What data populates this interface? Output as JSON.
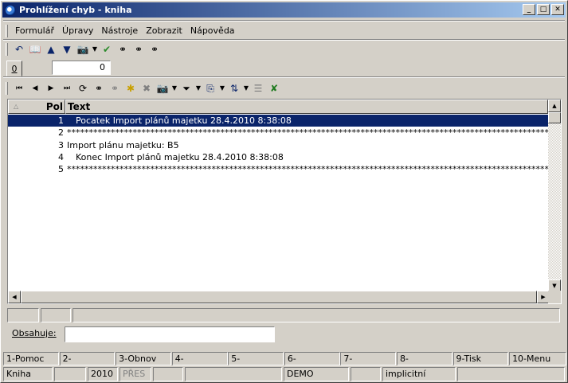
{
  "window": {
    "title": "Prohlížení chyb - kniha"
  },
  "menu": [
    "Formulář",
    "Úpravy",
    "Nástroje",
    "Zobrazit",
    "Nápověda"
  ],
  "toolbar1": {
    "icons": [
      "undo-icon",
      "book-icon",
      "arrow-up-icon",
      "arrow-down-icon",
      "camera-icon",
      "dropdown-arrow-icon",
      "filter-check-icon",
      "binoculars-icon",
      "binoculars-next-icon",
      "binoculars-prev-icon"
    ]
  },
  "tabs": {
    "active": "0"
  },
  "number_field": {
    "value": "0"
  },
  "toolbar2": {
    "icons": [
      "first-record-icon",
      "prev-record-icon",
      "next-record-icon",
      "last-record-icon",
      "refresh-icon",
      "binoculars-icon",
      "binoculars-disabled-icon",
      "star-add-icon",
      "delete-disabled-icon",
      "camera-icon",
      "filter-icon",
      "export-icon",
      "sort-icon",
      "columns-icon",
      "excel-icon"
    ]
  },
  "grid": {
    "columns": [
      "Pol",
      "Text"
    ],
    "rows": [
      {
        "num": "1",
        "text": "Pocatek Import plánů majetku 28.4.2010 8:38:08"
      },
      {
        "num": "2",
        "text": "**************************************************************************************************************************************************"
      },
      {
        "num": "3",
        "text": "Import plánu majetku: B5"
      },
      {
        "num": "4",
        "text": "Konec Import plánů majetku 28.4.2010 8:38:08"
      },
      {
        "num": "5",
        "text": "**************************************************************************************************************************************************"
      }
    ]
  },
  "filter": {
    "label": "Obsahuje:",
    "value": ""
  },
  "fkeys": [
    "1-Pomoc",
    "2-",
    "3-Obnov",
    "4-",
    "5-",
    "6-",
    "7-",
    "8-",
    "9-Tisk",
    "10-Menu"
  ],
  "status": {
    "module": "Kniha",
    "year": "2010",
    "mode": "PŘES",
    "db": "DEMO",
    "profile": "implicitní"
  }
}
